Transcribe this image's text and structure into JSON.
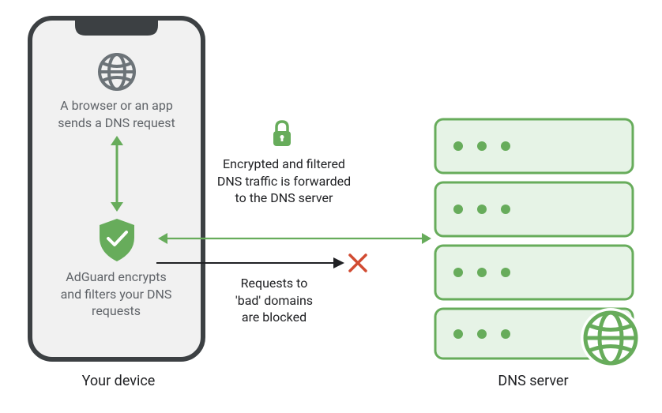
{
  "colors": {
    "green": "#67ac5b",
    "lightGreen": "#e6f3e6",
    "grey": "#6c7378",
    "border": "#3c4043",
    "red": "#d14b32",
    "text": "#5f6368",
    "textDark": "#202124"
  },
  "phone": {
    "caption": "Your device",
    "browserText": "A browser or an app\nsends a DNS request",
    "adguardText": "AdGuard encrypts\nand filters your DNS\nrequests"
  },
  "middle": {
    "encryptedText": "Encrypted and filtered\nDNS traffic is forwarded\nto the DNS server",
    "blockedText": "Requests to\n'bad' domains\nare blocked"
  },
  "server": {
    "caption": "DNS server"
  }
}
